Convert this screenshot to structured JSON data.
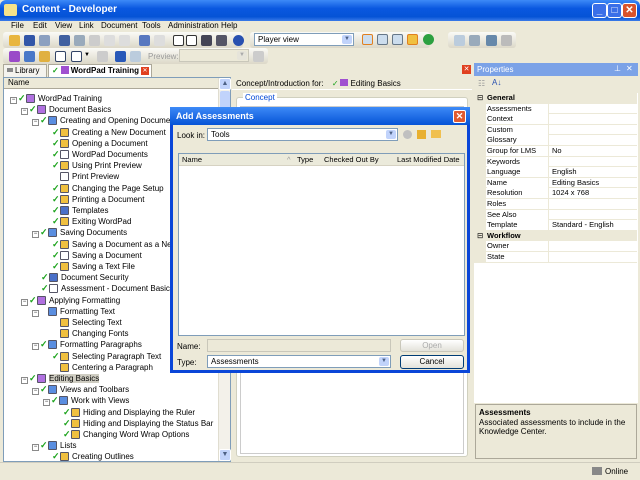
{
  "window": {
    "title": "Content - Developer",
    "min": "_",
    "max": "□",
    "close": "✕"
  },
  "menu": [
    "File",
    "Edit",
    "View",
    "Link",
    "Document",
    "Tools",
    "Administration",
    "Help"
  ],
  "toolbar": {
    "view_select": "Player view",
    "preview_label": "Preview:",
    "preview_value": ""
  },
  "tabs": [
    {
      "label": "Library"
    },
    {
      "label": "WordPad Training"
    }
  ],
  "tree": {
    "header": "Name",
    "rows": [
      {
        "label": "WordPad Training",
        "level": 0,
        "icon": "book",
        "check": true,
        "pm": "-"
      },
      {
        "label": "Document Basics",
        "level": 1,
        "icon": "book",
        "check": true,
        "pm": "-"
      },
      {
        "label": "Creating and Opening Documents",
        "level": 2,
        "icon": "section",
        "check": true,
        "pm": "-"
      },
      {
        "label": "Creating a New Document",
        "level": 3,
        "icon": "topic",
        "check": true
      },
      {
        "label": "Opening a Document",
        "level": 3,
        "icon": "topic",
        "check": true
      },
      {
        "label": "WordPad Documents",
        "level": 3,
        "icon": "question",
        "check": true
      },
      {
        "label": "Using Print Preview",
        "level": 3,
        "icon": "topic",
        "check": true
      },
      {
        "label": "Print Preview",
        "level": 3,
        "icon": "question",
        "check": false
      },
      {
        "label": "Changing the Page Setup",
        "level": 3,
        "icon": "topic",
        "check": true
      },
      {
        "label": "Printing a Document",
        "level": 3,
        "icon": "topic",
        "check": true
      },
      {
        "label": "Templates",
        "level": 3,
        "icon": "doc",
        "check": true
      },
      {
        "label": "Exiting WordPad",
        "level": 3,
        "icon": "topic",
        "check": true
      },
      {
        "label": "Saving Documents",
        "level": 2,
        "icon": "section",
        "check": true,
        "pm": "-"
      },
      {
        "label": "Saving a Document as a New File",
        "level": 3,
        "icon": "topic",
        "check": true
      },
      {
        "label": "Saving a Document",
        "level": 3,
        "icon": "question",
        "check": true
      },
      {
        "label": "Saving a Text File",
        "level": 3,
        "icon": "topic",
        "check": true
      },
      {
        "label": "Document Security",
        "level": 2,
        "icon": "doc",
        "check": true
      },
      {
        "label": "Assessment - Document Basics",
        "level": 2,
        "icon": "question",
        "check": true
      },
      {
        "label": "Applying Formatting",
        "level": 1,
        "icon": "book",
        "check": true,
        "pm": "-"
      },
      {
        "label": "Formatting Text",
        "level": 2,
        "icon": "section",
        "check": false,
        "pm": "-"
      },
      {
        "label": "Selecting Text",
        "level": 3,
        "icon": "topic",
        "check": false
      },
      {
        "label": "Changing Fonts",
        "level": 3,
        "icon": "topic",
        "check": false
      },
      {
        "label": "Formatting Paragraphs",
        "level": 2,
        "icon": "section",
        "check": true,
        "pm": "-"
      },
      {
        "label": "Selecting Paragraph Text",
        "level": 3,
        "icon": "topic",
        "check": true
      },
      {
        "label": "Centering a Paragraph",
        "level": 3,
        "icon": "topic",
        "check": false
      },
      {
        "label": "Editing Basics",
        "level": 1,
        "icon": "book",
        "check": true,
        "pm": "-",
        "selected": true
      },
      {
        "label": "Views and Toolbars",
        "level": 2,
        "icon": "section",
        "check": true,
        "pm": "-"
      },
      {
        "label": "Work with Views",
        "level": 3,
        "icon": "section",
        "check": true,
        "pm": "-"
      },
      {
        "label": "Hiding and Displaying the Ruler",
        "level": 4,
        "icon": "topic",
        "check": true
      },
      {
        "label": "Hiding and Displaying the Status Bar",
        "level": 4,
        "icon": "topic",
        "check": true
      },
      {
        "label": "Changing Word Wrap Options",
        "level": 4,
        "icon": "topic",
        "check": true
      },
      {
        "label": "Lists",
        "level": 2,
        "icon": "section",
        "check": true,
        "pm": "-"
      },
      {
        "label": "Creating Outlines",
        "level": 3,
        "icon": "topic",
        "check": true
      }
    ]
  },
  "concept": {
    "header_label": "Concept/Introduction for:",
    "header_item": "Editing Basics",
    "group_label": "Concept"
  },
  "properties": {
    "title": "Properties",
    "rows": [
      {
        "header": "General"
      },
      {
        "k": "Assessments",
        "v": ""
      },
      {
        "k": "Context",
        "v": ""
      },
      {
        "k": "Custom properties",
        "v": ""
      },
      {
        "k": "Glossary",
        "v": ""
      },
      {
        "k": "Group for LMS",
        "v": "No"
      },
      {
        "k": "Keywords",
        "v": ""
      },
      {
        "k": "Language",
        "v": "English"
      },
      {
        "k": "Name",
        "v": "Editing Basics"
      },
      {
        "k": "Resolution",
        "v": "1024 x 768"
      },
      {
        "k": "Roles",
        "v": ""
      },
      {
        "k": "See Also",
        "v": ""
      },
      {
        "k": "Template",
        "v": "Standard - English"
      },
      {
        "header": "Workflow"
      },
      {
        "k": "Owner",
        "v": ""
      },
      {
        "k": "State",
        "v": ""
      }
    ],
    "desc_title": "Assessments",
    "desc_text": "Associated assessments to include in the Knowledge Center."
  },
  "dialog": {
    "title": "Add Assessments",
    "look_in_label": "Look in:",
    "look_in_value": "Tools",
    "columns": [
      "Name",
      "Type",
      "Checked Out By",
      "Last Modified Date"
    ],
    "name_label": "Name:",
    "name_value": "",
    "type_label": "Type:",
    "type_value": "Assessments",
    "open": "Open",
    "cancel": "Cancel"
  },
  "status": {
    "online": "Online"
  }
}
